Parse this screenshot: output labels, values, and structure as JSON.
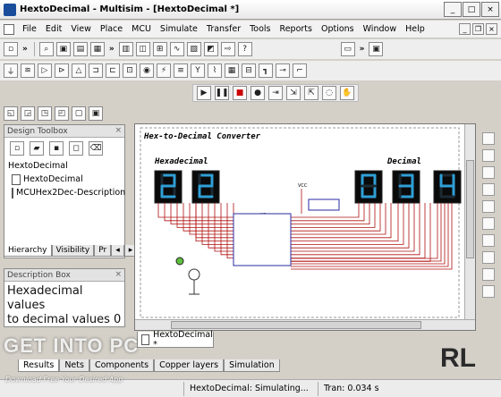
{
  "window": {
    "title": "HextoDecimal - Multisim - [HextoDecimal *]",
    "buttons": [
      "_",
      "□",
      "×"
    ]
  },
  "menu": {
    "items": [
      "File",
      "Edit",
      "View",
      "Place",
      "MCU",
      "Simulate",
      "Transfer",
      "Tools",
      "Reports",
      "Options",
      "Window",
      "Help"
    ],
    "mdi_buttons": [
      "_",
      "❐",
      "×"
    ]
  },
  "toolbar_chevron": "»",
  "design_toolbox": {
    "title": "Design Toolbox",
    "tree": [
      "HextoDecimal",
      "HextoDecimal",
      "MCUHex2Dec-Description"
    ],
    "tabs": [
      "Hierarchy",
      "Visibility",
      "Pr"
    ],
    "scroll_arrows": [
      "◂",
      "▸"
    ]
  },
  "description_box": {
    "title": "Description Box",
    "text_line1": "Hexadecimal values",
    "text_line2": "to decimal values 0"
  },
  "schematic": {
    "title": "Hex-to-Decimal Converter",
    "hex_label": "Hexadecimal",
    "dec_label": "Decimal",
    "hex_digits": [
      "2",
      "2"
    ],
    "dec_digits": [
      "0",
      "3",
      "4"
    ],
    "seg_color": "#2f9fd6",
    "wire_color": "#b01010",
    "vcc_label": "VCC",
    "chip_label": "U1",
    "chip_pin_count": 14
  },
  "doc_tab": "HextoDecimal *",
  "bottom_tabs": [
    "Results",
    "Nets",
    "Components",
    "Copper layers",
    "Simulation"
  ],
  "status": {
    "center": "HextoDecimal: Simulating...",
    "tran": "Tran: 0.034 s"
  },
  "watermark": {
    "main": "GET INTO PC",
    "sub": "Download Free Your Desired App"
  },
  "corner_logo": "RL"
}
